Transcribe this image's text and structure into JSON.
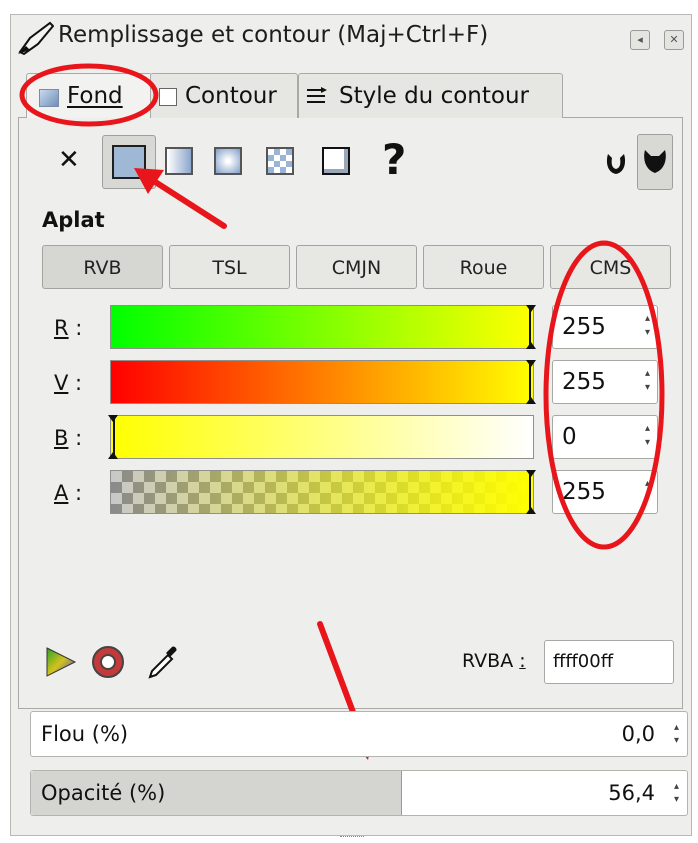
{
  "dialog": {
    "title": "Remplissage et contour (Maj+Ctrl+F)",
    "window_buttons": [
      "◂",
      "✕"
    ]
  },
  "tabs": [
    {
      "label": "Fond",
      "selected": true
    },
    {
      "label": "Contour",
      "selected": false
    },
    {
      "label": "Style du contour",
      "selected": false
    }
  ],
  "fill_types": [
    "none",
    "flat",
    "linear-gradient",
    "radial-gradient",
    "pattern",
    "swatch",
    "unset"
  ],
  "fill_type_selected": "flat",
  "unset_glyph": "?",
  "none_glyph": "✕",
  "section_title": "Aplat",
  "color_modes": [
    "RVB",
    "TSL",
    "CMJN",
    "Roue",
    "CMS"
  ],
  "color_mode_selected": "RVB",
  "channels": [
    {
      "letter": "R",
      "suffix": " :",
      "value": "255"
    },
    {
      "letter": "V",
      "suffix": " :",
      "value": "255"
    },
    {
      "letter": "B",
      "suffix": " :",
      "value": "0"
    },
    {
      "letter": "A",
      "suffix": " :",
      "value": "255"
    }
  ],
  "rgba": {
    "label": "RVBA",
    "colon": ":",
    "value": "ffff00ff"
  },
  "blur": {
    "label": "Flou (%)",
    "value": "0,0"
  },
  "opacity": {
    "label": "Opacité (%)",
    "value": "56,4",
    "fraction": 0.564
  },
  "colors": {
    "annotation_red": "#e8161a",
    "selected_swatch": "#9fb8d6",
    "current_color": "#ffff00"
  },
  "icons": {
    "eyedropper": "eyedropper-icon",
    "color_managed": "color-managed-icon",
    "out_of_gamut": "out-of-gamut-icon",
    "fill_rule_evenodd": "fill-rule-evenodd-icon",
    "fill_rule_nonzero": "fill-rule-nonzero-icon"
  }
}
